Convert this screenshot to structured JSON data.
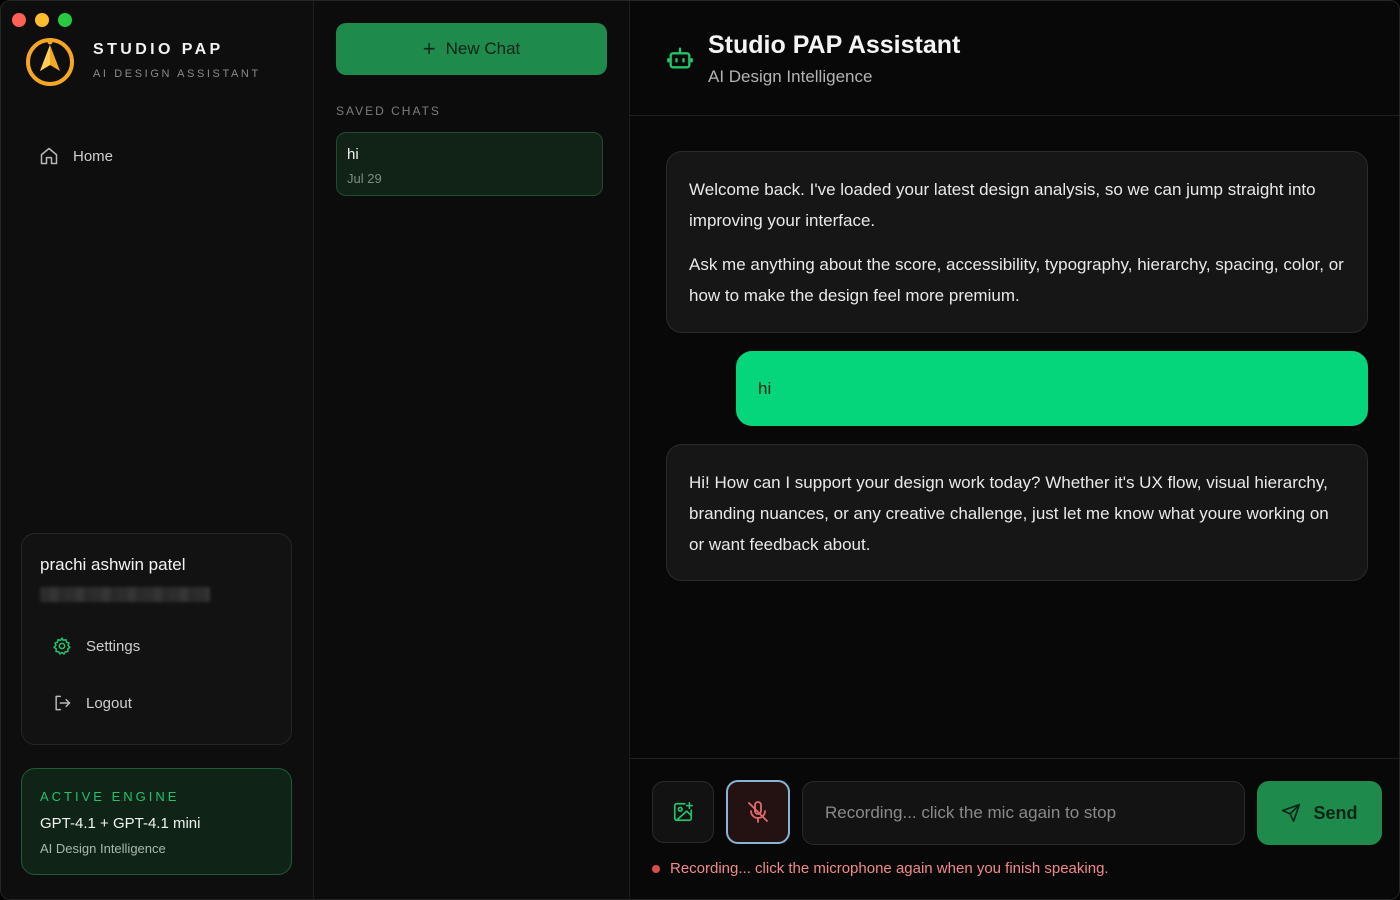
{
  "colors": {
    "accent": "#1e8a4c",
    "user_bubble": "#05d67c",
    "recording": "#f08a8a",
    "logo": "#f5a623"
  },
  "brand": {
    "name": "STUDIO PAP",
    "subtitle": "AI DESIGN ASSISTANT",
    "logo_icon": "compass-a-logo"
  },
  "sidebar": {
    "nav": [
      {
        "label": "Home",
        "icon": "home-icon"
      }
    ]
  },
  "user": {
    "name": "prachi ashwin patel",
    "actions": [
      {
        "label": "Settings",
        "icon": "gear-icon"
      },
      {
        "label": "Logout",
        "icon": "logout-icon"
      }
    ]
  },
  "engine": {
    "kicker": "ACTIVE ENGINE",
    "name": "GPT-4.1 + GPT-4.1 mini",
    "subtitle": "AI Design Intelligence"
  },
  "chats": {
    "new_chat_label": "New Chat",
    "section_label": "SAVED CHATS",
    "items": [
      {
        "title": "hi",
        "date": "Jul 29"
      }
    ]
  },
  "header": {
    "title": "Studio PAP Assistant",
    "subtitle": "AI Design Intelligence",
    "icon": "robot-icon"
  },
  "messages": [
    {
      "role": "assistant",
      "paragraphs": [
        "Welcome back. I've loaded your latest design analysis, so we can jump straight into improving your interface.",
        "Ask me anything about the score, accessibility, typography, hierarchy, spacing, color, or how to make the design feel more premium."
      ]
    },
    {
      "role": "user",
      "text": "hi"
    },
    {
      "role": "assistant",
      "paragraphs": [
        "Hi! How can I support your design work today? Whether it's UX flow, visual hierarchy, branding nuances, or any creative challenge, just let me know what youre working on or want feedback about."
      ]
    }
  ],
  "composer": {
    "placeholder": "Recording... click the mic again to stop",
    "value": "",
    "send_label": "Send",
    "status": "Recording... click the microphone again when you finish speaking."
  }
}
